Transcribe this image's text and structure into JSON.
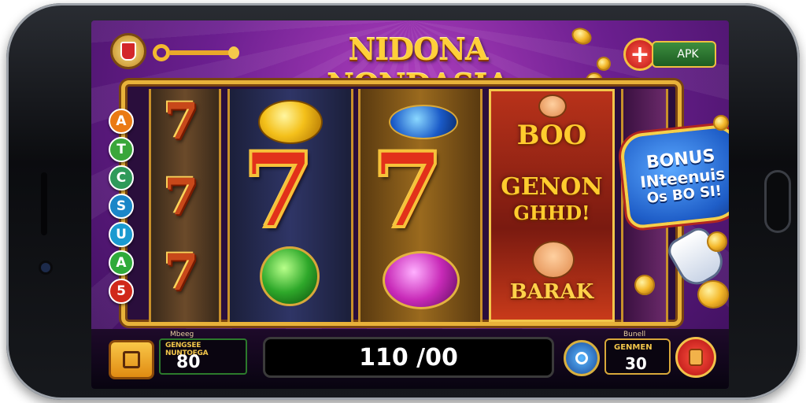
{
  "game": {
    "title": "NIDONA NONDASIA",
    "top_right_button": "APK",
    "plus_button": "+"
  },
  "side_letters": [
    {
      "label": "A",
      "color": "#ea7a14"
    },
    {
      "label": "T",
      "color": "#3aa63a"
    },
    {
      "label": "C",
      "color": "#2f9a5a"
    },
    {
      "label": "S",
      "color": "#1a86c8"
    },
    {
      "label": "U",
      "color": "#1a9ad0"
    },
    {
      "label": "A",
      "color": "#2faa3a"
    },
    {
      "label": "5",
      "color": "#d0281a"
    }
  ],
  "reels": {
    "reel1": [
      "7",
      "7",
      "7"
    ],
    "reel2": {
      "top": "gold-gem",
      "middle": "7",
      "bottom": "green-gem"
    },
    "reel3": {
      "top": "blue-star-gem",
      "middle": "7",
      "bottom": "pink-gem"
    },
    "reel4": {
      "line1": "BOO",
      "line2": "GENON",
      "line3": "GHHD!",
      "line4": "BARAK"
    }
  },
  "bonus": {
    "line1": "BONUS",
    "line2": "INteenuis",
    "line3": "Os BO SI!"
  },
  "bottom_bar": {
    "balance_small_label": "Mbeeg",
    "balance_header": "GENGSEE NUNTOEGA",
    "balance_value": "80",
    "win_value": "110 /00",
    "bet_small_label": "Bunell",
    "bet_header": "GENMEN",
    "bet_value": "30"
  },
  "colors": {
    "title_gold": "#ffcf3a",
    "background_purple": "#6b1f8f",
    "frame_gold": "#e8b23a",
    "seven_red": "#e2311a"
  }
}
